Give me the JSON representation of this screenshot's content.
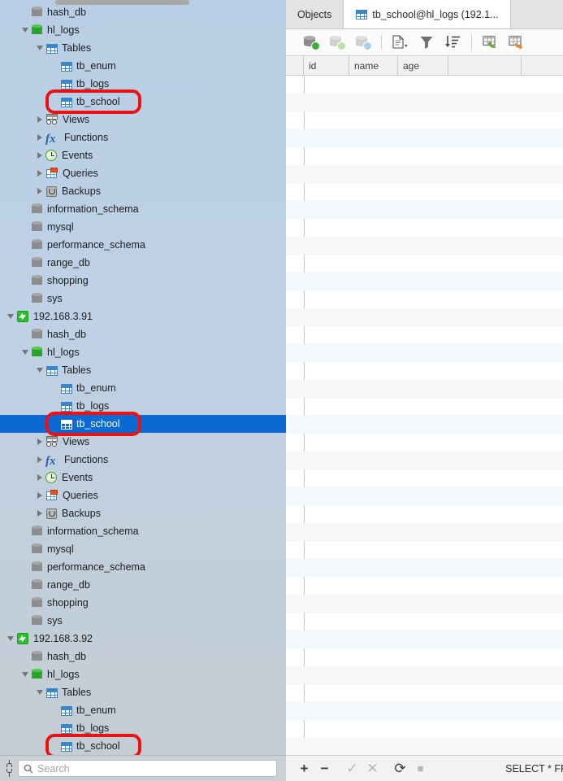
{
  "sidebar": {
    "search": {
      "placeholder": "Search",
      "value": ""
    },
    "plug_icon": "connection-icon",
    "tree": [
      {
        "indent": 1,
        "twisty": "none",
        "icon": "db-gray",
        "label": "hash_db"
      },
      {
        "indent": 1,
        "twisty": "open",
        "icon": "db-green",
        "label": "hl_logs"
      },
      {
        "indent": 2,
        "twisty": "open",
        "icon": "grid",
        "label": "Tables"
      },
      {
        "indent": 3,
        "twisty": "none",
        "icon": "grid",
        "label": "tb_enum"
      },
      {
        "indent": 3,
        "twisty": "none",
        "icon": "grid",
        "label": "tb_logs"
      },
      {
        "indent": 3,
        "twisty": "none",
        "icon": "grid",
        "label": "tb_school",
        "boxed": true
      },
      {
        "indent": 2,
        "twisty": "closed",
        "icon": "views",
        "label": "Views"
      },
      {
        "indent": 2,
        "twisty": "closed",
        "icon": "fx",
        "label": "Functions"
      },
      {
        "indent": 2,
        "twisty": "closed",
        "icon": "clock",
        "label": "Events"
      },
      {
        "indent": 2,
        "twisty": "closed",
        "icon": "queries",
        "label": "Queries"
      },
      {
        "indent": 2,
        "twisty": "closed",
        "icon": "backups",
        "label": "Backups"
      },
      {
        "indent": 1,
        "twisty": "none",
        "icon": "db-gray",
        "label": "information_schema"
      },
      {
        "indent": 1,
        "twisty": "none",
        "icon": "db-gray",
        "label": "mysql"
      },
      {
        "indent": 1,
        "twisty": "none",
        "icon": "db-gray",
        "label": "performance_schema"
      },
      {
        "indent": 1,
        "twisty": "none",
        "icon": "db-gray",
        "label": "range_db"
      },
      {
        "indent": 1,
        "twisty": "none",
        "icon": "db-gray",
        "label": "shopping"
      },
      {
        "indent": 1,
        "twisty": "none",
        "icon": "db-gray",
        "label": "sys"
      },
      {
        "indent": 0,
        "twisty": "open",
        "icon": "conn",
        "label": "192.168.3.91"
      },
      {
        "indent": 1,
        "twisty": "none",
        "icon": "db-gray",
        "label": "hash_db"
      },
      {
        "indent": 1,
        "twisty": "open",
        "icon": "db-green",
        "label": "hl_logs"
      },
      {
        "indent": 2,
        "twisty": "open",
        "icon": "grid",
        "label": "Tables"
      },
      {
        "indent": 3,
        "twisty": "none",
        "icon": "grid",
        "label": "tb_enum"
      },
      {
        "indent": 3,
        "twisty": "none",
        "icon": "grid",
        "label": "tb_logs"
      },
      {
        "indent": 3,
        "twisty": "none",
        "icon": "grid",
        "label": "tb_school",
        "boxed": true,
        "selected": true
      },
      {
        "indent": 2,
        "twisty": "closed",
        "icon": "views",
        "label": "Views"
      },
      {
        "indent": 2,
        "twisty": "closed",
        "icon": "fx",
        "label": "Functions"
      },
      {
        "indent": 2,
        "twisty": "closed",
        "icon": "clock",
        "label": "Events"
      },
      {
        "indent": 2,
        "twisty": "closed",
        "icon": "queries",
        "label": "Queries"
      },
      {
        "indent": 2,
        "twisty": "closed",
        "icon": "backups",
        "label": "Backups"
      },
      {
        "indent": 1,
        "twisty": "none",
        "icon": "db-gray",
        "label": "information_schema"
      },
      {
        "indent": 1,
        "twisty": "none",
        "icon": "db-gray",
        "label": "mysql"
      },
      {
        "indent": 1,
        "twisty": "none",
        "icon": "db-gray",
        "label": "performance_schema"
      },
      {
        "indent": 1,
        "twisty": "none",
        "icon": "db-gray",
        "label": "range_db"
      },
      {
        "indent": 1,
        "twisty": "none",
        "icon": "db-gray",
        "label": "shopping"
      },
      {
        "indent": 1,
        "twisty": "none",
        "icon": "db-gray",
        "label": "sys"
      },
      {
        "indent": 0,
        "twisty": "open",
        "icon": "conn",
        "label": "192.168.3.92"
      },
      {
        "indent": 1,
        "twisty": "none",
        "icon": "db-gray",
        "label": "hash_db"
      },
      {
        "indent": 1,
        "twisty": "open",
        "icon": "db-green",
        "label": "hl_logs"
      },
      {
        "indent": 2,
        "twisty": "open",
        "icon": "grid",
        "label": "Tables"
      },
      {
        "indent": 3,
        "twisty": "none",
        "icon": "grid",
        "label": "tb_enum"
      },
      {
        "indent": 3,
        "twisty": "none",
        "icon": "grid",
        "label": "tb_logs"
      },
      {
        "indent": 3,
        "twisty": "none",
        "icon": "grid",
        "label": "tb_school",
        "boxed": true
      }
    ]
  },
  "main": {
    "tabs": [
      {
        "label": "Objects",
        "icon": "none",
        "active": false
      },
      {
        "label": "tb_school@hl_logs (192.1...",
        "icon": "grid",
        "active": true
      }
    ],
    "toolbar": [
      {
        "name": "begin-transaction-button",
        "icon": "db-play"
      },
      {
        "name": "commit-button",
        "icon": "db-check"
      },
      {
        "name": "rollback-button",
        "icon": "db-rollback"
      },
      {
        "name": "separator-1",
        "icon": "sep"
      },
      {
        "name": "form-view-button",
        "icon": "document-dropdown"
      },
      {
        "name": "filter-button",
        "icon": "filter"
      },
      {
        "name": "sort-button",
        "icon": "sort-desc"
      },
      {
        "name": "separator-2",
        "icon": "sep"
      },
      {
        "name": "import-wizard-button",
        "icon": "table-import"
      },
      {
        "name": "export-wizard-button",
        "icon": "table-export"
      }
    ],
    "columns": [
      {
        "label": "id",
        "width": 56
      },
      {
        "label": "name",
        "width": 60
      },
      {
        "label": "age",
        "width": 62
      },
      {
        "label": "",
        "width": 90
      }
    ],
    "rows": [],
    "statusbar": {
      "buttons": [
        {
          "name": "add-record-button",
          "glyph": "+",
          "enabled": true
        },
        {
          "name": "delete-record-button",
          "glyph": "−",
          "enabled": true
        },
        {
          "name": "apply-changes-button",
          "glyph": "✓",
          "enabled": false
        },
        {
          "name": "cancel-changes-button",
          "glyph": "✕",
          "enabled": false
        },
        {
          "name": "refresh-button",
          "glyph": "⟳",
          "enabled": true
        },
        {
          "name": "stop-button",
          "glyph": "■",
          "enabled": false
        }
      ],
      "sql": "SELECT * FR"
    }
  },
  "colors": {
    "selection_blue": "#0b69d4",
    "annotation_red": "#ee1111",
    "db_green": "#35ae32",
    "grid_blue": "#3b86c7"
  }
}
